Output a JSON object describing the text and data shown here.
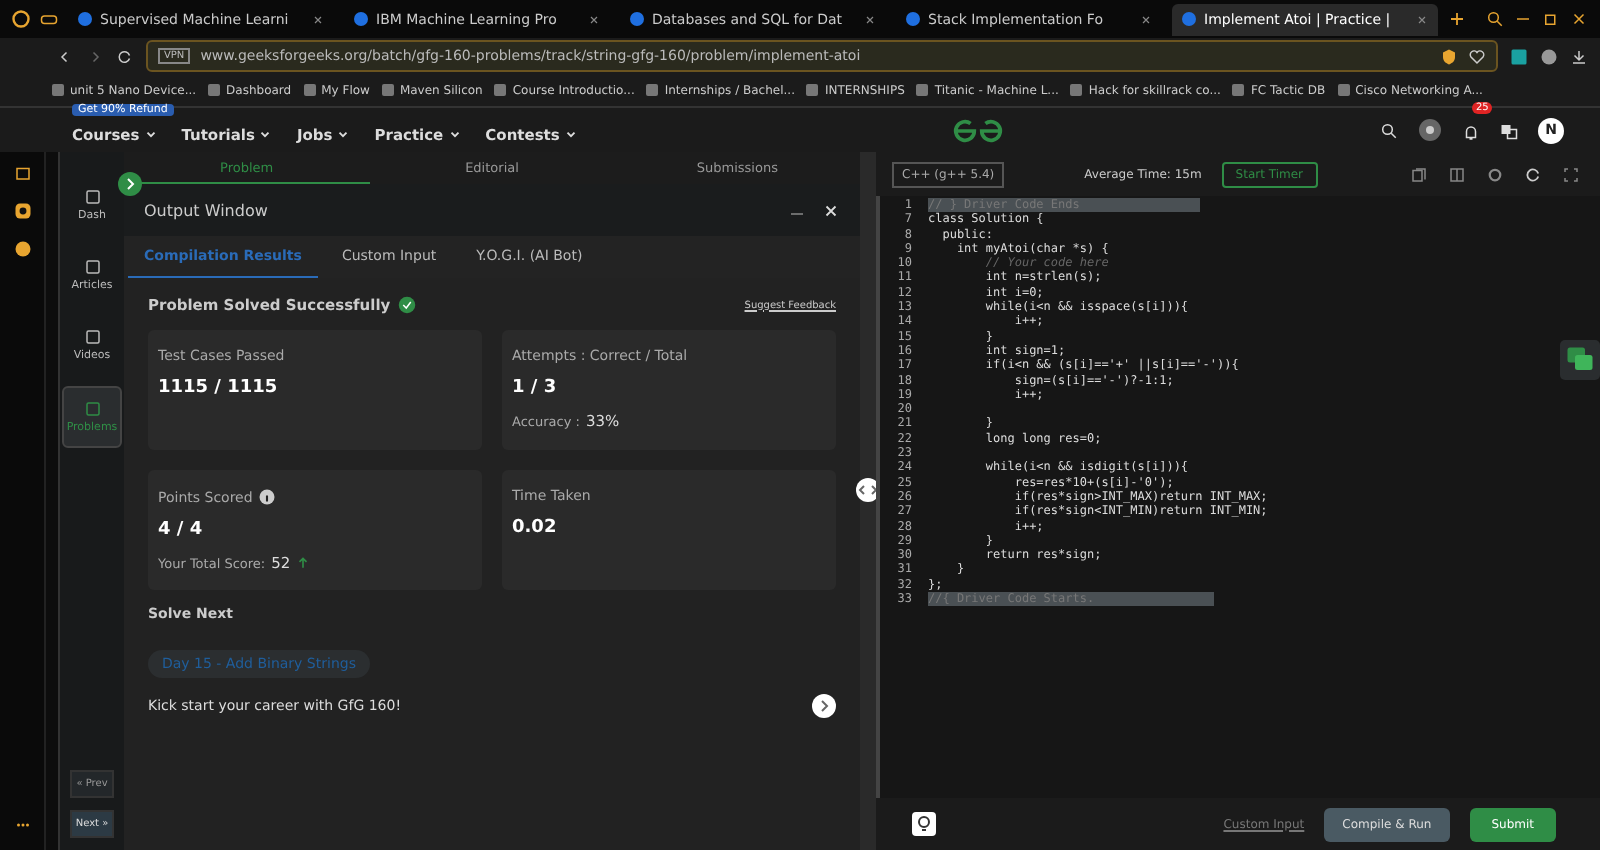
{
  "browser_tabs": [
    {
      "title": "Supervised Machine Learni",
      "selected": false
    },
    {
      "title": "IBM Machine Learning Pro",
      "selected": false
    },
    {
      "title": "Databases and SQL for Dat",
      "selected": false
    },
    {
      "title": "Stack Implementation Fo",
      "selected": false
    },
    {
      "title": "Implement Atoi | Practice |",
      "selected": true
    }
  ],
  "address_bar": {
    "badge": "VPN",
    "url": "www.geeksforgeeks.org/batch/gfg-160-problems/track/string-gfg-160/problem/implement-atoi"
  },
  "bookmarks": [
    "unit 5 Nano Device...",
    "Dashboard",
    "My Flow",
    "Maven Silicon",
    "Course Introductio...",
    "Internships / Bachel...",
    "INTERNSHIPS",
    "Titanic - Machine L...",
    "Hack for skillrack co...",
    "FC Tactic DB",
    "Cisco Networking A..."
  ],
  "site_nav": {
    "promo": "Get 90% Refund",
    "menus": [
      "Courses",
      "Tutorials",
      "Jobs",
      "Practice",
      "Contests"
    ],
    "notifications": "25",
    "avatar": "N"
  },
  "side_nav": {
    "items": [
      {
        "label": "Dash",
        "selected": false
      },
      {
        "label": "Articles",
        "selected": false
      },
      {
        "label": "Videos",
        "selected": false
      },
      {
        "label": "Problems",
        "selected": true
      }
    ],
    "prev": "« Prev",
    "next": "Next »"
  },
  "problem_tabs": [
    {
      "label": "Problem",
      "selected": true
    },
    {
      "label": "Editorial",
      "selected": false
    },
    {
      "label": "Submissions",
      "selected": false
    }
  ],
  "output_window": {
    "title": "Output Window",
    "tabs": [
      {
        "label": "Compilation Results",
        "selected": true
      },
      {
        "label": "Custom Input",
        "selected": false
      },
      {
        "label": "Y.O.G.I. (AI Bot)",
        "selected": false
      }
    ],
    "status": "Problem Solved Successfully",
    "feedback_link": "Suggest Feedback",
    "cards": [
      {
        "label": "Test Cases Passed",
        "value": "1115 / 1115"
      },
      {
        "label": "Attempts : Correct / Total",
        "value": "1 / 3",
        "note": "Accuracy :",
        "note_value": "33%"
      },
      {
        "label": "Points Scored",
        "value": "4 / 4",
        "info": true,
        "note": "Your Total Score:",
        "note_value": "52",
        "up": true
      },
      {
        "label": "Time Taken",
        "value": "0.02"
      }
    ],
    "solve_next": "Solve Next",
    "next_problem": "Day 15 - Add Binary Strings",
    "promo": "Kick start your career with GfG 160!"
  },
  "editor": {
    "language": "C++ (g++ 5.4)",
    "avg_time": "Average Time: 15m",
    "timer": "Start Timer",
    "lines": [
      {
        "n": "1",
        "kind": "folded",
        "text": "// } Driver Code Ends"
      },
      {
        "n": "7",
        "kind": "code",
        "text": "class Solution {"
      },
      {
        "n": "8",
        "kind": "code",
        "text": "  public:"
      },
      {
        "n": "9",
        "kind": "code",
        "text": "    int myAtoi(char *s) {"
      },
      {
        "n": "10",
        "kind": "comment",
        "text": "        // Your code here"
      },
      {
        "n": "11",
        "kind": "code",
        "text": "        int n=strlen(s);"
      },
      {
        "n": "12",
        "kind": "code",
        "text": "        int i=0;"
      },
      {
        "n": "13",
        "kind": "code",
        "text": "        while(i<n && isspace(s[i])){"
      },
      {
        "n": "14",
        "kind": "code",
        "text": "            i++;"
      },
      {
        "n": "15",
        "kind": "code",
        "text": "        }"
      },
      {
        "n": "16",
        "kind": "code",
        "text": "        int sign=1;"
      },
      {
        "n": "17",
        "kind": "code",
        "text": "        if(i<n && (s[i]=='+' ||s[i]=='-')){"
      },
      {
        "n": "18",
        "kind": "code",
        "text": "            sign=(s[i]=='-')?-1:1;"
      },
      {
        "n": "19",
        "kind": "code",
        "text": "            i++;"
      },
      {
        "n": "20"
      },
      {
        "n": "21",
        "kind": "code",
        "text": "        }"
      },
      {
        "n": "22",
        "kind": "code",
        "text": "        long long res=0;"
      },
      {
        "n": "23"
      },
      {
        "n": "24",
        "kind": "code",
        "text": "        while(i<n && isdigit(s[i])){"
      },
      {
        "n": "25",
        "kind": "code",
        "text": "            res=res*10+(s[i]-'0');"
      },
      {
        "n": "26",
        "kind": "code",
        "text": "            if(res*sign>INT_MAX)return INT_MAX;"
      },
      {
        "n": "27",
        "kind": "code",
        "text": "            if(res*sign<INT_MIN)return INT_MIN;"
      },
      {
        "n": "28",
        "kind": "code",
        "text": "            i++;"
      },
      {
        "n": "29",
        "kind": "code",
        "text": "        }"
      },
      {
        "n": "30",
        "kind": "code",
        "text": "        return res*sign;"
      },
      {
        "n": "31",
        "kind": "code",
        "text": "    }"
      },
      {
        "n": "32",
        "kind": "code",
        "text": "};"
      },
      {
        "n": "33",
        "kind": "folded",
        "text": "//{ Driver Code Starts."
      }
    ],
    "custom_input": "Custom Input",
    "run": "Compile & Run",
    "submit": "Submit"
  }
}
